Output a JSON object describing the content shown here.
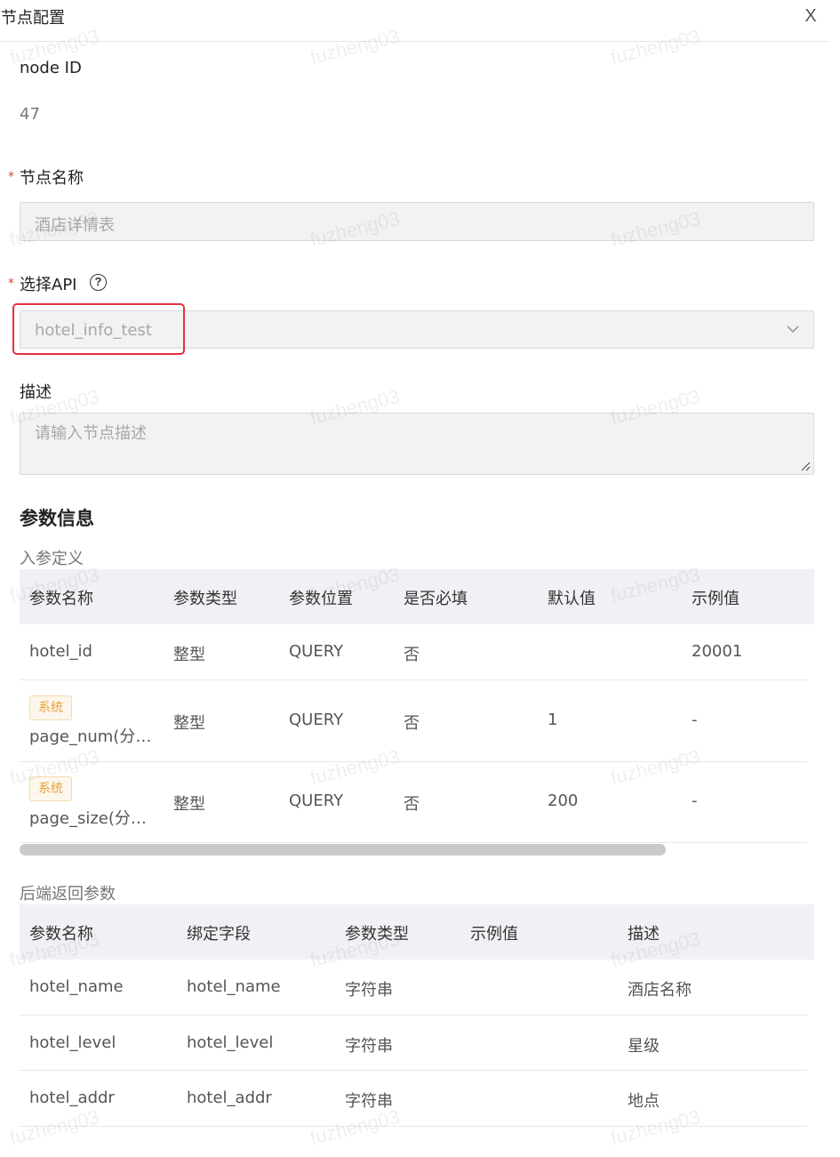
{
  "header": {
    "title": "节点配置",
    "close_label": "X"
  },
  "node_id": {
    "label": "node ID",
    "value": "47"
  },
  "node_name": {
    "required_mark": "*",
    "label": "节点名称",
    "value": "酒店详情表"
  },
  "api": {
    "required_mark": "*",
    "label": "选择API",
    "help_icon": "?",
    "value": "hotel_info_test"
  },
  "description": {
    "label": "描述",
    "placeholder": "请输入节点描述"
  },
  "params": {
    "title": "参数信息",
    "input_title": "入参定义",
    "input_headers": [
      "参数名称",
      "参数类型",
      "参数位置",
      "是否必填",
      "默认值",
      "示例值"
    ],
    "input_rows": [
      {
        "badge": "",
        "name": "hotel_id",
        "type": "整型",
        "position": "QUERY",
        "required": "否",
        "default": "",
        "example": "20001"
      },
      {
        "badge": "系统",
        "name": "page_num(分…",
        "type": "整型",
        "position": "QUERY",
        "required": "否",
        "default": "1",
        "example": "-"
      },
      {
        "badge": "系统",
        "name": "page_size(分…",
        "type": "整型",
        "position": "QUERY",
        "required": "否",
        "default": "200",
        "example": "-"
      }
    ],
    "output_title": "后端返回参数",
    "output_headers": [
      "参数名称",
      "绑定字段",
      "参数类型",
      "示例值",
      "描述"
    ],
    "output_rows": [
      {
        "name": "hotel_name",
        "field": "hotel_name",
        "type": "字符串",
        "example": "",
        "desc": "酒店名称"
      },
      {
        "name": "hotel_level",
        "field": "hotel_level",
        "type": "字符串",
        "example": "",
        "desc": "星级"
      },
      {
        "name": "hotel_addr",
        "field": "hotel_addr",
        "type": "字符串",
        "example": "",
        "desc": "地点"
      }
    ]
  },
  "watermark": "fuzheng03",
  "colors": {
    "required": "#e0403a",
    "highlight": "#e3303d",
    "badge_text": "#e6a23c",
    "badge_bg": "#fdf6ec"
  }
}
